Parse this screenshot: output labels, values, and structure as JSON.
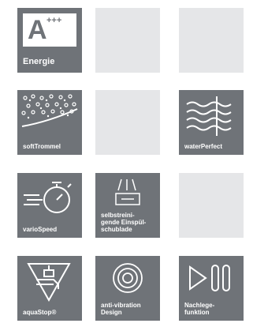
{
  "features": [
    {
      "id": "energie",
      "label": "Energie",
      "grade": "A",
      "grade_plus": "+++",
      "icon": "energy-label-icon"
    },
    {
      "id": "softtrommel",
      "label": "softTrommel",
      "icon": "drum-dots-icon"
    },
    {
      "id": "waterperfect",
      "label": "waterPerfect",
      "icon": "water-waves-icon"
    },
    {
      "id": "variospeed",
      "label": "varioSpeed",
      "icon": "stopwatch-icon"
    },
    {
      "id": "selbstreinigend",
      "label": "selbstreini-\ngende Einspül-\nschublade",
      "icon": "detergent-drawer-icon"
    },
    {
      "id": "aquastop",
      "label": "aquaStop®",
      "icon": "tap-shield-icon"
    },
    {
      "id": "antivibration",
      "label": "anti-vibration\nDesign",
      "icon": "vibration-rings-icon"
    },
    {
      "id": "nachlegefunktion",
      "label": "Nachlege-\nfunktion",
      "icon": "play-pause-icon"
    }
  ],
  "colors": {
    "tile": "#6f7378",
    "empty_tile": "#e5e6e8",
    "text": "#ffffff"
  }
}
